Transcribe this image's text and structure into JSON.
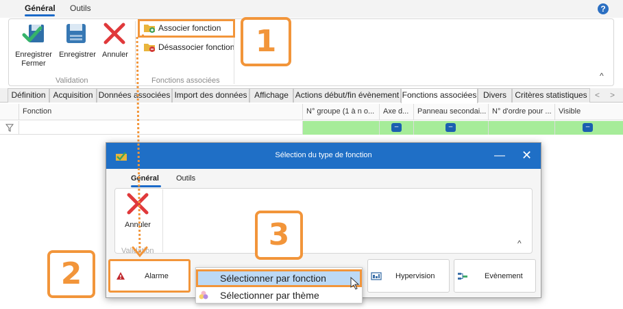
{
  "main": {
    "tabs": [
      {
        "label": "Général",
        "active": true
      },
      {
        "label": "Outils",
        "active": false
      }
    ],
    "help": "?",
    "ribbon": {
      "groups": [
        {
          "label": "Validation",
          "buttons": [
            {
              "label": "Enregistrer Fermer",
              "icon": "save-close-icon"
            },
            {
              "label": "Enregistrer",
              "icon": "save-icon"
            },
            {
              "label": "Annuler",
              "icon": "cancel-x-icon"
            }
          ]
        },
        {
          "label": "Fonctions associées",
          "buttons": [
            {
              "label": "Associer fonction",
              "icon": "folder-add-icon"
            },
            {
              "label": "Désassocier fonction",
              "icon": "folder-remove-icon"
            }
          ]
        }
      ],
      "collapse": "^"
    },
    "doc_tabs": [
      {
        "label": "Définition"
      },
      {
        "label": "Acquisition"
      },
      {
        "label": "Données associées"
      },
      {
        "label": "Import des données"
      },
      {
        "label": "Affichage"
      },
      {
        "label": "Actions début/fin évènement"
      },
      {
        "label": "Fonctions associées",
        "active": true
      },
      {
        "label": "Divers"
      },
      {
        "label": "Critères statistiques"
      }
    ],
    "tab_nav": {
      "prev": "<",
      "next": ">"
    },
    "grid": {
      "columns": [
        {
          "label": "Fonction"
        },
        {
          "label": "N° groupe (1 à n o..."
        },
        {
          "label": "Axe d..."
        },
        {
          "label": "Panneau secondai..."
        },
        {
          "label": "N° d'ordre pour ..."
        },
        {
          "label": "Visible"
        }
      ],
      "filter_button": "–"
    }
  },
  "dialog": {
    "title": "Sélection du type de fonction",
    "tabs": [
      {
        "label": "Général",
        "active": true
      },
      {
        "label": "Outils",
        "active": false
      }
    ],
    "cancel_label": "Annuler",
    "group_label": "Validation",
    "collapse": "^",
    "categories": [
      {
        "label": "Alarme",
        "icon": "warning-icon"
      },
      {
        "label": "Hypervision",
        "icon": "hypervision-icon"
      },
      {
        "label": "Evènement",
        "icon": "event-icon"
      }
    ],
    "dropdown": [
      {
        "label": "Sélectionner par fonction"
      },
      {
        "label": "Sélectionner par thème"
      }
    ]
  },
  "callouts": [
    "1",
    "2",
    "3"
  ],
  "colors": {
    "accent": "#1f6fc6",
    "callout": "#f2953a",
    "grid_green": "#a6ec99",
    "hover": "#bcd9f5"
  }
}
